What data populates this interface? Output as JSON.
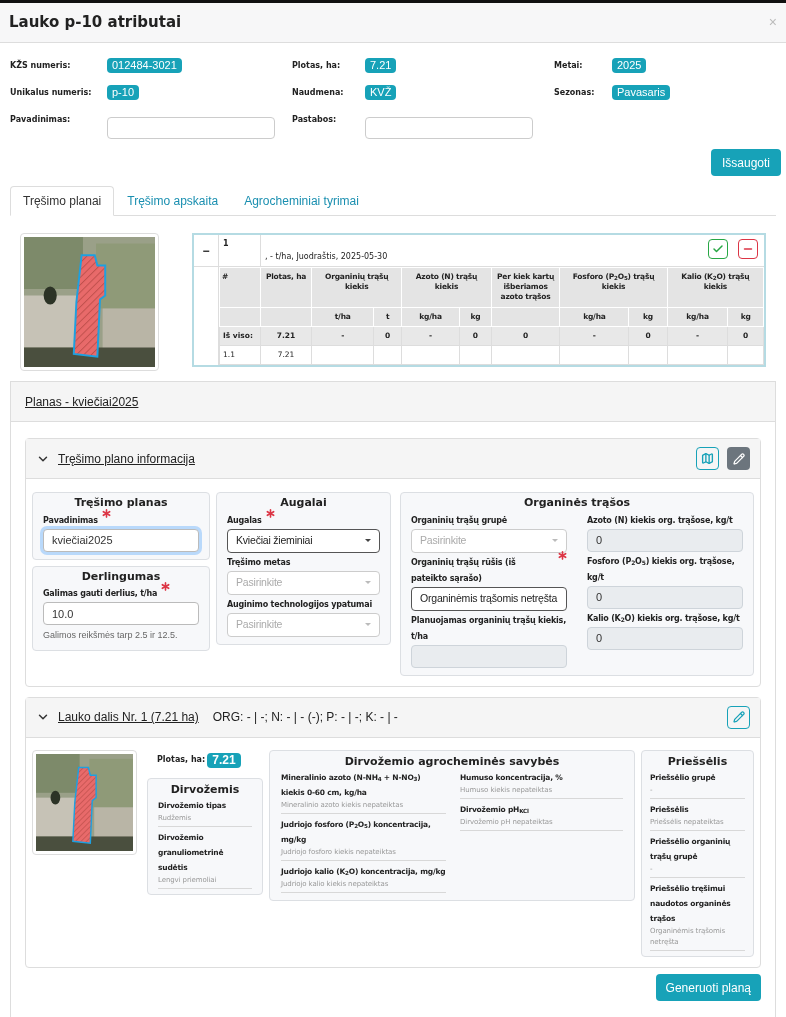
{
  "window": {
    "title": "Lauko p-10 atributai",
    "close": "×"
  },
  "attributes": [
    [
      {
        "label": "KŽS numeris:",
        "kind": "badge",
        "value": "012484-3021"
      },
      {
        "label": "Plotas, ha:",
        "kind": "badge",
        "value": "7.21"
      },
      {
        "label": "Metai:",
        "kind": "badge",
        "value": "2025"
      }
    ],
    [
      {
        "label": "Unikalus numeris:",
        "kind": "badge",
        "value": "p-10"
      },
      {
        "label": "Naudmena:",
        "kind": "badge",
        "value": "KVŽ"
      },
      {
        "label": "Sezonas:",
        "kind": "badge",
        "value": "Pavasaris"
      }
    ],
    [
      {
        "label": "Pavadinimas:",
        "kind": "input"
      },
      {
        "label": "Pastabos:",
        "kind": "input"
      }
    ]
  ],
  "save_button": "Išsaugoti",
  "tabs": [
    {
      "label": "Tręšimo planai",
      "selected": true
    },
    {
      "label": "Tręšimo apskaita",
      "selected": false
    },
    {
      "label": "Agrocheminiai tyrimai",
      "selected": false
    }
  ],
  "plans_table": {
    "toggle": "−",
    "number": "1",
    "summary": ", - t/ha, Juodraštis, 2025-05-30",
    "columns": [
      {
        "title": "#"
      },
      {
        "title": "Plotas, ha"
      },
      {
        "title": "Organinių trąšų kiekis",
        "colspan": 2,
        "units": [
          "t/ha",
          "t"
        ]
      },
      {
        "title": "Azoto (N) trąšų kiekis",
        "colspan": 2,
        "units": [
          "kg/ha",
          "kg"
        ]
      },
      {
        "title": "Per kiek kartų išberiamos azoto trąšos"
      },
      {
        "title": "Fosforo (P$_{2}$O$_{5}$) trąšų kiekis",
        "colspan": 2,
        "units": [
          "kg/ha",
          "kg"
        ]
      },
      {
        "title": "Kalio (K$_{2}$O) trąšų kiekis",
        "colspan": 2,
        "units": [
          "kg/ha",
          "kg"
        ]
      }
    ],
    "rows": [
      {
        "kind": "total",
        "cells": [
          "Iš viso:",
          "7.21",
          "-",
          "0",
          "-",
          "0",
          "0",
          "-",
          "0",
          "-",
          "0"
        ]
      },
      {
        "kind": "item",
        "cells": [
          "1.1",
          "7.21"
        ]
      }
    ]
  },
  "plan": {
    "title": "Planas - kviečiai2025",
    "info": {
      "title": "Tręšimo plano informacija",
      "expanded": true,
      "columns": [
        [
          {
            "title": "Tręšimo planas",
            "fields": [
              {
                "label": "Pavadinimas",
                "required": true,
                "kind": "input",
                "value": "kviečiai2025",
                "focused": true,
                "disabled": false
              }
            ]
          },
          {
            "title": "Derlingumas",
            "fields": [
              {
                "label": "Galimas gauti derlius, t/ha",
                "required": true,
                "kind": "input",
                "value": "10.0",
                "disabled": false,
                "help": "Galimos reikšmės tarp 2.5 ir 12.5."
              }
            ]
          }
        ],
        [
          {
            "title": "Augalai",
            "fields": [
              {
                "label": "Augalas",
                "required": true,
                "kind": "select",
                "value": "Kviečiai žieminiai",
                "disabled": false
              },
              {
                "label": "Tręšimo metas",
                "required": false,
                "kind": "select",
                "placeholder": "Pasirinkite",
                "disabled": true
              },
              {
                "label": "Auginimo technologijos ypatumai",
                "required": false,
                "kind": "select",
                "placeholder": "Pasirinkite",
                "disabled": true
              }
            ]
          }
        ],
        [
          {
            "title": "Organinės trąšos",
            "field_columns": [
              [
                {
                  "label": "Organinių trąšų grupė",
                  "required": false,
                  "kind": "select",
                  "placeholder": "Pasirinkite",
                  "disabled": true
                },
                {
                  "label": "Organinių trąšų rūšis (iš pateikto sąrašo)",
                  "required": true,
                  "kind": "select",
                  "value": "Organinėmis trąšomis netręšta",
                  "disabled": false
                },
                {
                  "label": "Planuojamas organinių trąšų kiekis, t/ha",
                  "required": false,
                  "kind": "input",
                  "disabled": true
                }
              ],
              [
                {
                  "label": "Azoto (N) kiekis org. trąšose, kg/t",
                  "required": false,
                  "kind": "input",
                  "value": "0",
                  "disabled": true
                },
                {
                  "label": "Fosforo (P$_{2}$O$_{5}$) kiekis org. trąšose, kg/t",
                  "required": false,
                  "kind": "input",
                  "value": "0",
                  "disabled": true
                },
                {
                  "label": "Kalio (K$_{2}$O) kiekis org. trąšose, kg/t",
                  "required": false,
                  "kind": "input",
                  "value": "0",
                  "disabled": true
                }
              ]
            ]
          }
        ]
      ]
    },
    "plot": {
      "title": "Lauko dalis Nr. 1 (7.21 ha)",
      "summary": "ORG: - | -; N: - | - (-); P: - | -; K: - | -",
      "expanded": true,
      "area_label": "Plotas, ha:",
      "area": "7.21",
      "soil": {
        "title": "Dirvožemis",
        "items": [
          {
            "label": "Dirvožemio tipas",
            "value": "Rudžemis"
          },
          {
            "label": "Dirvožemio granuliometrinė sudėtis",
            "value": "Lengvi priemoliai"
          }
        ]
      },
      "agrochem": {
        "title": "Dirvožemio agrocheminės savybės",
        "columns": [
          [
            {
              "label": "Mineralinio azoto (N-NH$_{4}$ + N-NO$_{3}$) kiekis 0-60 cm, kg/ha",
              "value": "Mineralinio azoto kiekis nepateiktas"
            },
            {
              "label": "Judriojo fosforo (P$_{2}$O$_{5}$) koncentracija, mg/kg",
              "value": "Judriojo fosforo kiekis nepateiktas"
            },
            {
              "label": "Judriojo kalio (K$_{2}$O) koncentracija, mg/kg",
              "value": "Judriojo kalio kiekis nepateiktas"
            }
          ],
          [
            {
              "label": "Humuso koncentracija, %",
              "value": "Humuso kiekis nepateiktas"
            },
            {
              "label": "Dirvožemio pH$_{KCl}$",
              "value": "Dirvožemio pH nepateiktas"
            }
          ]
        ]
      },
      "predecessor": {
        "title": "Priešsėlis",
        "items": [
          {
            "label": "Priešsėlio grupė",
            "value": "-"
          },
          {
            "label": "Priešsėlis",
            "value": "Priešsėlis nepateiktas"
          },
          {
            "label": "Priešsėlio organinių trąšų grupė",
            "value": "-"
          },
          {
            "label": "Priešsėlio tręšimui naudotos organinės trąšos",
            "value": "Organinėmis trąšomis netręšta"
          }
        ]
      }
    },
    "generate_button": "Generuoti planą"
  }
}
